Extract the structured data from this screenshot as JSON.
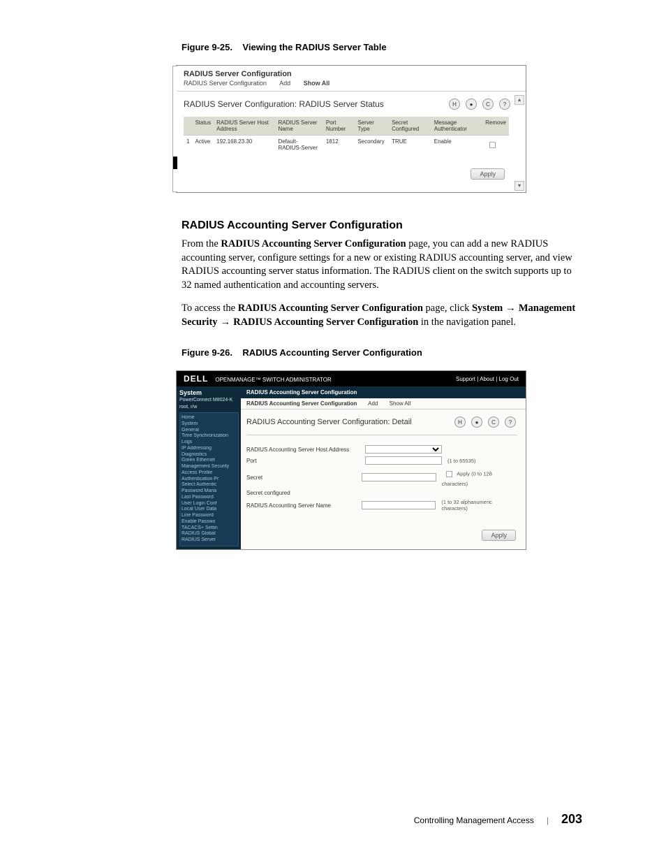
{
  "figure25": {
    "caption_head": "Figure 9-25.",
    "caption_title": "Viewing the RADIUS Server Table",
    "panel_title": "RADIUS Server Configuration",
    "tabs": {
      "t1": "RADIUS Server Configuration",
      "t2": "Add",
      "t3": "Show All"
    },
    "page_title": "RADIUS Server Configuration: RADIUS Server Status",
    "columns": {
      "c0": "",
      "c1": "Status",
      "c2": "RADIUS Server Host Address",
      "c3": "RADIUS Server Name",
      "c4": "Port Number",
      "c5": "Server Type",
      "c6": "Secret Configured",
      "c7": "Message Authenticator",
      "c8": "Remove"
    },
    "row": {
      "idx": "1",
      "status": "Active",
      "host": "192.168.23.30",
      "name": "Default-RADIUS-Server",
      "port": "1812",
      "type": "Secondary",
      "secret": "TRUE",
      "msgauth": "Enable"
    },
    "apply": "Apply"
  },
  "section": {
    "heading": "RADIUS Accounting Server Configuration",
    "para1_a": "From the ",
    "para1_b": "RADIUS Accounting Server Configuration",
    "para1_c": " page, you can add a new RADIUS accounting server, configure settings for a new or existing RADIUS accounting server, and view RADIUS accounting server status information. The RADIUS client on the switch supports up to 32 named authentication and accounting servers.",
    "para2_a": "To access the ",
    "para2_b": "RADIUS Accounting Server Configuration",
    "para2_c": " page, click ",
    "para2_d": "System",
    "arrow": " → ",
    "para2_e": "Management Security",
    "para2_f": "RADIUS Accounting Server Configuration",
    "para2_g": " in the navigation panel."
  },
  "figure26": {
    "caption_head": "Figure 9-26.",
    "caption_title": "RADIUS Accounting Server Configuration",
    "logo": "DELL",
    "product": "OPENMANAGE™ SWITCH ADMINISTRATOR",
    "toplinks": "Support | About | Log Out",
    "sidebar": {
      "system": "System",
      "model": "PowerConnect M8024-K",
      "user": "root, r/w",
      "items": {
        "home": "Home",
        "sys": "System",
        "general": "General",
        "timesync": "Time Synchronization",
        "logs": "Logs",
        "ip": "IP Addressing",
        "diag": "Diagnostics",
        "green": "Green Ethernet",
        "mgmt": "Management Security",
        "access": "Access Profile",
        "auth": "Authentication Pr",
        "selauth": "Select Authentic",
        "pwdmgmt": "Password Mana",
        "lastpwd": "Last Password",
        "userlogin": "User Login Conf",
        "localuser": "Local User Data",
        "linepwd": "Line Password",
        "enablepwd": "Enable Passwo",
        "tacacs": "TACACS+ Settin",
        "radglob": "RADIUS Global",
        "radsrv": "RADIUS Server"
      }
    },
    "crumb1": "RADIUS Accounting Server Configuration",
    "crumb2": {
      "t1": "RADIUS Accounting Server Configuration",
      "t2": "Add",
      "t3": "Show All"
    },
    "detail_title": "RADIUS Accounting Server Configuration: Detail",
    "form": {
      "f1": "RADIUS Accounting Server Host Address",
      "f2": "Port",
      "f2hint": "(1 to 65535)",
      "f3": "Secret",
      "f3hint": "Apply  (0 to 128 characters)",
      "f4": "Secret configured",
      "f5": "RADIUS Accounting Server Name",
      "f5hint": "(1 to 32 alphanumeric characters)"
    },
    "apply": "Apply"
  },
  "footer": {
    "chapter": "Controlling Management Access",
    "page": "203"
  }
}
